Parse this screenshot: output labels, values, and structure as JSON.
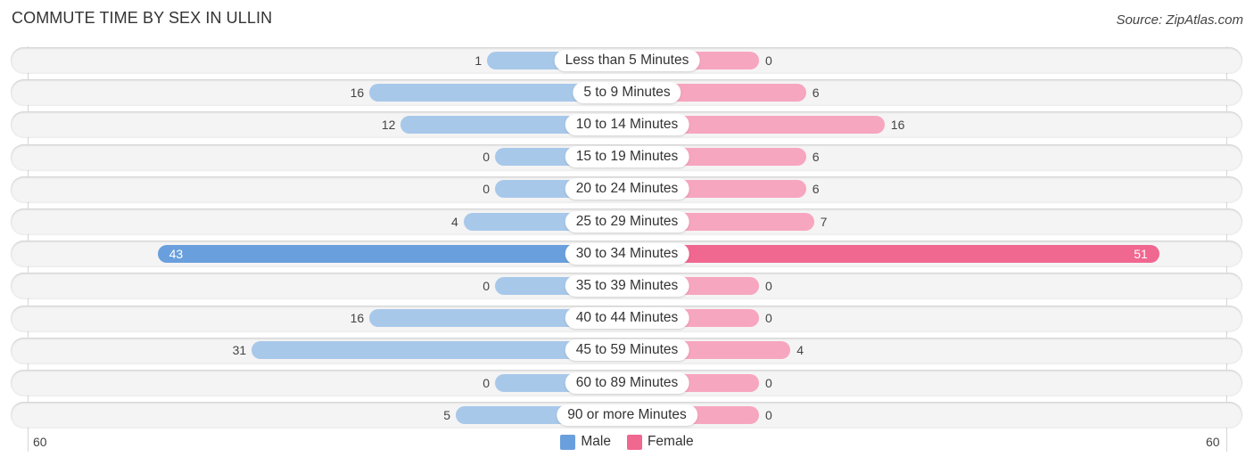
{
  "chart_data": {
    "type": "bar",
    "orientation": "horizontal-diverging",
    "title": "COMMUTE TIME BY SEX IN ULLIN",
    "source": "Source: ZipAtlas.com",
    "categories": [
      "Less than 5 Minutes",
      "5 to 9 Minutes",
      "10 to 14 Minutes",
      "15 to 19 Minutes",
      "20 to 24 Minutes",
      "25 to 29 Minutes",
      "30 to 34 Minutes",
      "35 to 39 Minutes",
      "40 to 44 Minutes",
      "45 to 59 Minutes",
      "60 to 89 Minutes",
      "90 or more Minutes"
    ],
    "series": [
      {
        "name": "Male",
        "color": "#6a9fdd",
        "light_color": "#a8c8ea",
        "values": [
          1,
          16,
          12,
          0,
          0,
          4,
          43,
          0,
          16,
          31,
          0,
          5
        ]
      },
      {
        "name": "Female",
        "color": "#f06790",
        "light_color": "#f7a6bf",
        "values": [
          0,
          6,
          16,
          6,
          6,
          7,
          51,
          0,
          0,
          4,
          0,
          0
        ]
      }
    ],
    "axis": {
      "left_tick": "60",
      "right_tick": "60",
      "range": [
        -60,
        60
      ]
    },
    "legend": {
      "position": "bottom-center",
      "entries": [
        "Male",
        "Female"
      ]
    }
  }
}
